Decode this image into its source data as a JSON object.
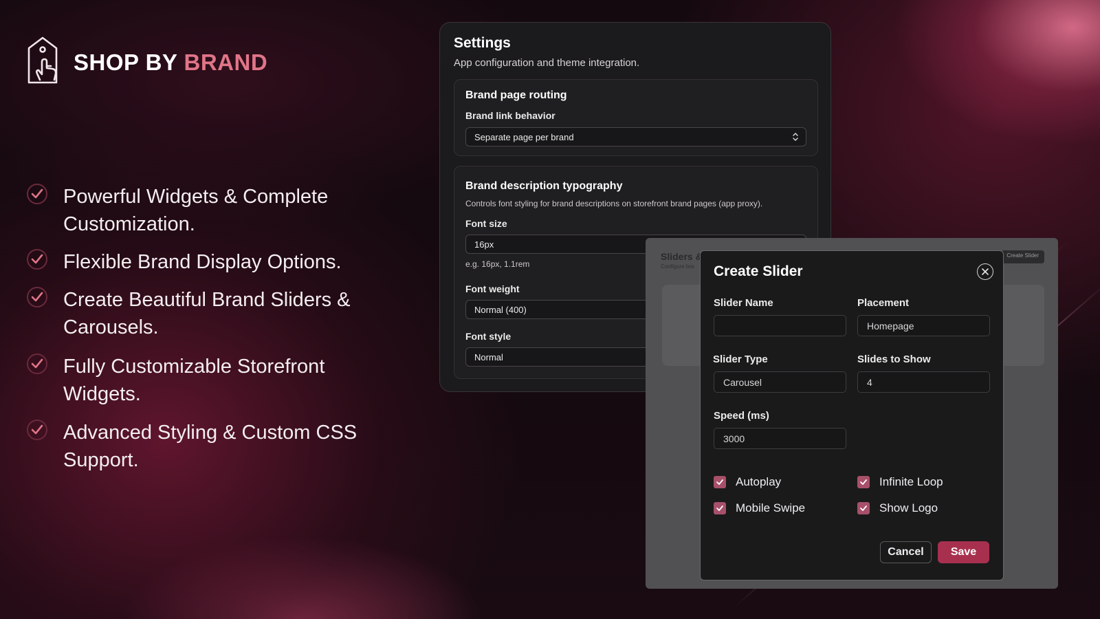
{
  "brand": {
    "title_main": "SHOP BY",
    "title_accent": "BRAND",
    "accent_color": "#e07588",
    "logo_icon": "tag-hand-icon"
  },
  "features": [
    {
      "text": "Powerful Widgets & Complete Customization.",
      "icon": "check-circle-icon"
    },
    {
      "text": "Flexible Brand Display Options.",
      "icon": "check-circle-icon"
    },
    {
      "text": "Create Beautiful Brand Sliders & Carousels.",
      "icon": "check-circle-icon"
    },
    {
      "text": "Fully Customizable Storefront Widgets.",
      "icon": "check-circle-icon"
    },
    {
      "text": "Advanced Styling & Custom CSS Support.",
      "icon": "check-circle-icon"
    }
  ],
  "settings": {
    "title": "Settings",
    "subtitle": "App configuration and theme integration.",
    "routing": {
      "title": "Brand page routing",
      "link_behavior_label": "Brand link behavior",
      "link_behavior_value": "Separate page per brand"
    },
    "typography": {
      "title": "Brand description typography",
      "description": "Controls font styling for brand descriptions on storefront brand pages (app proxy).",
      "font_size_label": "Font size",
      "font_size_value": "16px",
      "font_size_help": "e.g. 16px, 1.1rem",
      "font_weight_label": "Font weight",
      "font_weight_value": "Normal (400)",
      "font_style_label": "Font style",
      "font_style_value": "Normal"
    }
  },
  "background_page": {
    "title": "Sliders &",
    "subtitle": "Configure bra",
    "button": "Create Slider"
  },
  "modal": {
    "title": "Create Slider",
    "slider_name_label": "Slider Name",
    "slider_name_value": "",
    "placement_label": "Placement",
    "placement_value": "Homepage",
    "slider_type_label": "Slider Type",
    "slider_type_value": "Carousel",
    "slides_to_show_label": "Slides to Show",
    "slides_to_show_value": "4",
    "speed_label": "Speed (ms)",
    "speed_value": "3000",
    "checkboxes": {
      "autoplay": {
        "label": "Autoplay",
        "checked": true
      },
      "infinite_loop": {
        "label": "Infinite Loop",
        "checked": true
      },
      "mobile_swipe": {
        "label": "Mobile Swipe",
        "checked": true
      },
      "show_logo": {
        "label": "Show Logo",
        "checked": true
      }
    },
    "cancel_label": "Cancel",
    "save_label": "Save",
    "save_color": "#a8304f"
  }
}
